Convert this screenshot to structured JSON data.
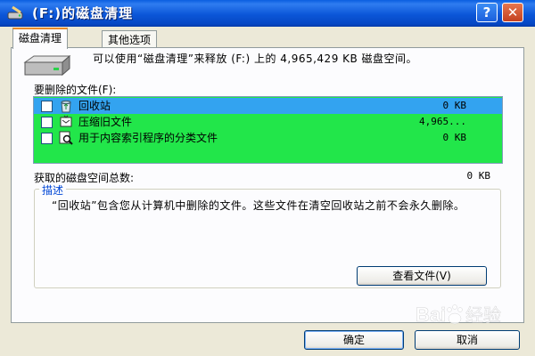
{
  "window": {
    "title": "(F:)的磁盘清理",
    "help_label": "?",
    "close_label": "✕"
  },
  "tabs": [
    {
      "label": "磁盘清理",
      "active": true
    },
    {
      "label": "其他选项",
      "active": false
    }
  ],
  "intro": {
    "text": "可以使用“磁盘清理”来释放 (F:) 上的 4,965,429 KB 磁盘空间。"
  },
  "file_list": {
    "label": "要删除的文件(F):",
    "items": [
      {
        "name": "回收站",
        "size": "0 KB",
        "checked": false,
        "selected": true,
        "icon": "recycle-bin-icon"
      },
      {
        "name": "压缩旧文件",
        "size": "4,965...",
        "checked": false,
        "selected": false,
        "icon": "compress-icon"
      },
      {
        "name": "用于内容索引程序的分类文件",
        "size": "0 KB",
        "checked": false,
        "selected": false,
        "icon": "index-search-icon"
      }
    ]
  },
  "total": {
    "label": "获取的磁盘空间总数:",
    "value": "0 KB"
  },
  "description": {
    "legend": "描述",
    "text": "“回收站”包含您从计算机中删除的文件。这些文件在清空回收站之前不会永久删除。"
  },
  "buttons": {
    "view_files": "查看文件(V)",
    "ok": "确定",
    "cancel": "取消"
  },
  "watermark": {
    "text": "Bai 经验"
  },
  "colors": {
    "list_background": "#22e64a",
    "selection": "#33a3f0",
    "titlebar": "#0b56d8"
  }
}
